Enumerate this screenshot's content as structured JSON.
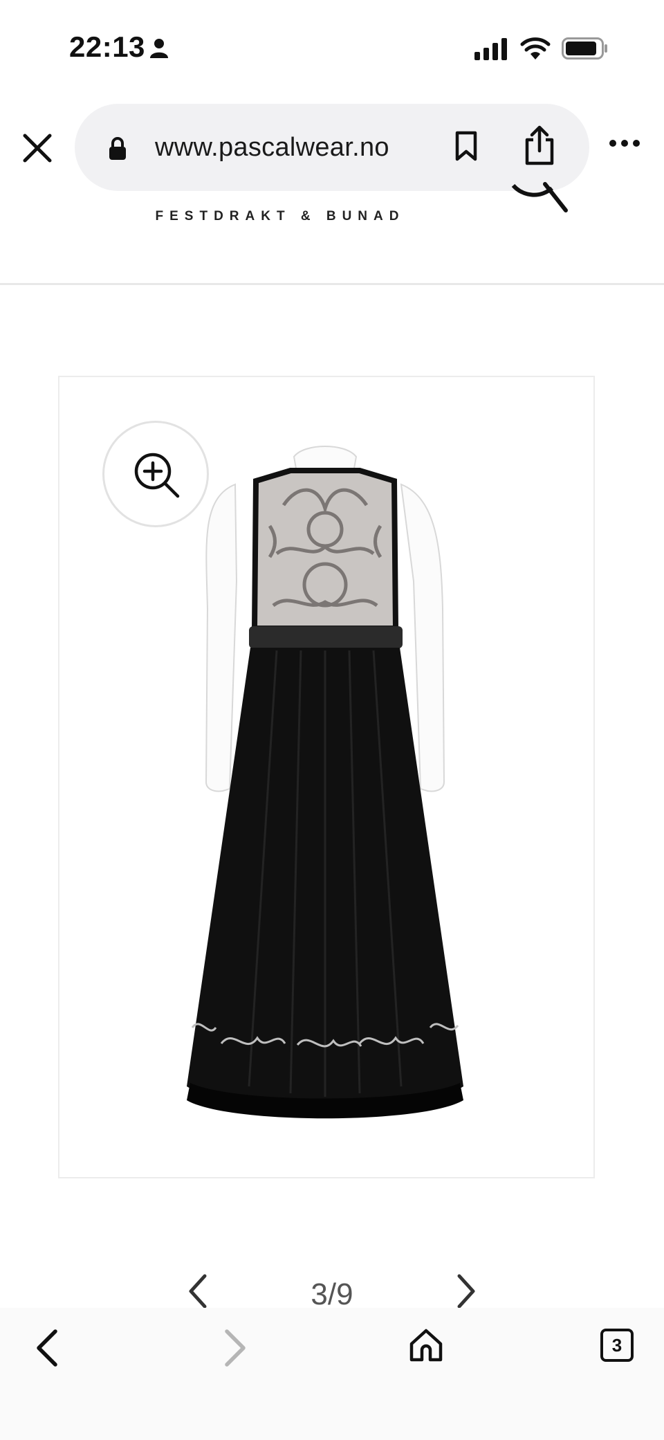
{
  "status_bar": {
    "time": "22:13",
    "icons": [
      "person-icon",
      "signal-icon",
      "wifi-icon",
      "battery-icon"
    ]
  },
  "browser": {
    "url": "www.pascalwear.no",
    "buttons": [
      "close-icon",
      "lock-icon",
      "bookmark-icon",
      "share-icon",
      "more-icon"
    ]
  },
  "site": {
    "tagline": "FESTDRAKT & BUNAD"
  },
  "gallery": {
    "page_counter": "3/9",
    "current": 3,
    "total": 9
  },
  "toolbar": {
    "tab_count": "3",
    "buttons": [
      "back-arrow-icon",
      "forward-arrow-icon",
      "home-icon",
      "tabs-icon"
    ]
  },
  "colors": {
    "url_pill_bg": "#f1f1f3",
    "divider": "#e8e8e8",
    "frame_border": "#ececec"
  }
}
